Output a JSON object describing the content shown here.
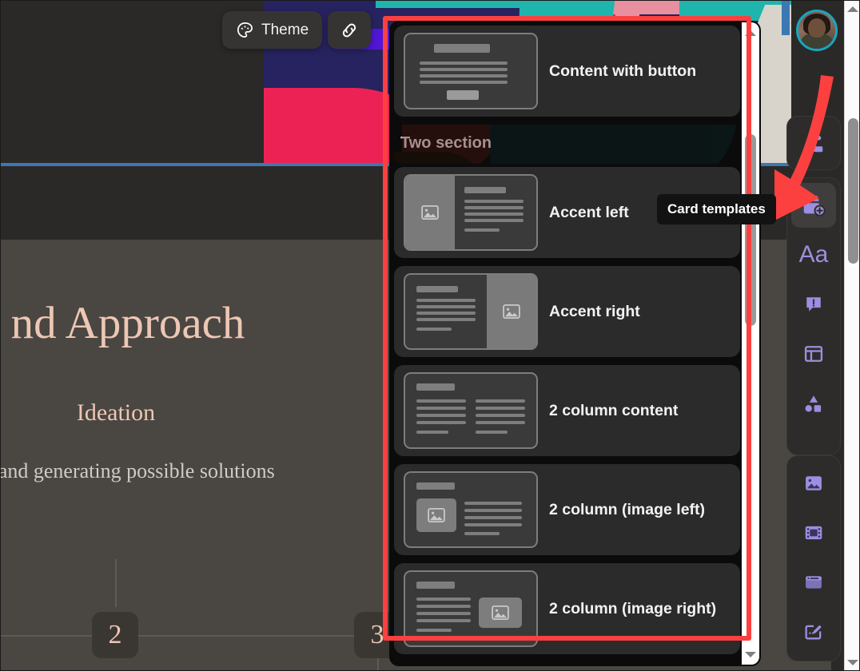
{
  "toolbar": {
    "theme_label": "Theme",
    "theme_icon": "palette-icon",
    "link_icon": "link-icon"
  },
  "slide": {
    "title": "nd Approach",
    "subtitle": "Ideation",
    "description": "orming and generating possible solutions",
    "timeline_nodes": [
      "2",
      "3"
    ]
  },
  "popover": {
    "title": "Card templates",
    "groups": [
      {
        "header": "",
        "items": [
          {
            "label": "Content with button",
            "thumb": "content-with-button"
          }
        ]
      },
      {
        "header": "Two section",
        "items": [
          {
            "label": "Accent left",
            "thumb": "accent-left"
          },
          {
            "label": "Accent right",
            "thumb": "accent-right"
          },
          {
            "label": "2 column content",
            "thumb": "two-column-content"
          },
          {
            "label": "2 column (image left)",
            "thumb": "two-column-image-left"
          },
          {
            "label": "2 column (image right)",
            "thumb": "two-column-image-right"
          }
        ]
      }
    ]
  },
  "tooltip": {
    "text": "Card templates"
  },
  "rail": {
    "groups": [
      {
        "items": [
          {
            "name": "add-person-icon",
            "label": "Add person"
          }
        ]
      },
      {
        "items": [
          {
            "name": "card-templates-icon",
            "label": "Card templates",
            "active": true
          },
          {
            "name": "text-icon",
            "label": "Text",
            "glyph": "Aa"
          },
          {
            "name": "callout-icon",
            "label": "Callout box"
          },
          {
            "name": "layout-icon",
            "label": "Layout"
          },
          {
            "name": "shapes-icon",
            "label": "Shapes and diagrams"
          }
        ]
      },
      {
        "items": [
          {
            "name": "image-icon",
            "label": "Image"
          },
          {
            "name": "video-icon",
            "label": "Video"
          },
          {
            "name": "embed-icon",
            "label": "Embed"
          },
          {
            "name": "drawing-icon",
            "label": "Drawing"
          }
        ]
      }
    ]
  },
  "avatar": {
    "name": "user-avatar"
  },
  "annotation": {
    "box_color": "#fc4040",
    "arrow_color": "#fc4040"
  },
  "colors": {
    "accent": "#9b8fe0",
    "slide_title": "#edc7b4",
    "panel_bg": "#0b0b0b",
    "card_bg": "#2b2b2b"
  }
}
